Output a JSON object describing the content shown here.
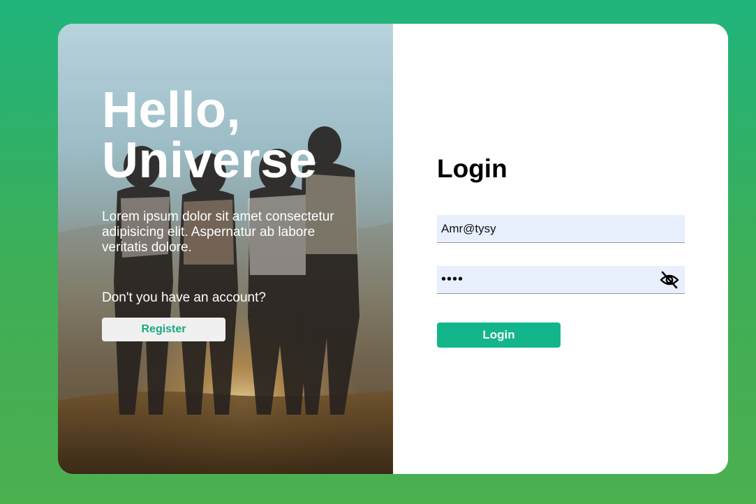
{
  "hero": {
    "title_line1": "Hello,",
    "title_line2": "Universe",
    "text": "Lorem ipsum dolor sit amet consectetur adipisicing elit. Aspernatur ab labore veritatis dolore.",
    "question": "Don't you have an account?",
    "register_label": "Register",
    "image_description": "group-of-friends-hugging-at-sunset-photo"
  },
  "login": {
    "title": "Login",
    "email_value": "Amr@tysy",
    "password_value": "••••",
    "password_toggle_icon": "eye-slash-icon",
    "submit_label": "Login"
  },
  "colors": {
    "background_top": "#20b47c",
    "background_bottom": "#4caf50",
    "accent": "#13b58a",
    "register_text": "#1aa882",
    "input_bg": "#e8effd"
  }
}
